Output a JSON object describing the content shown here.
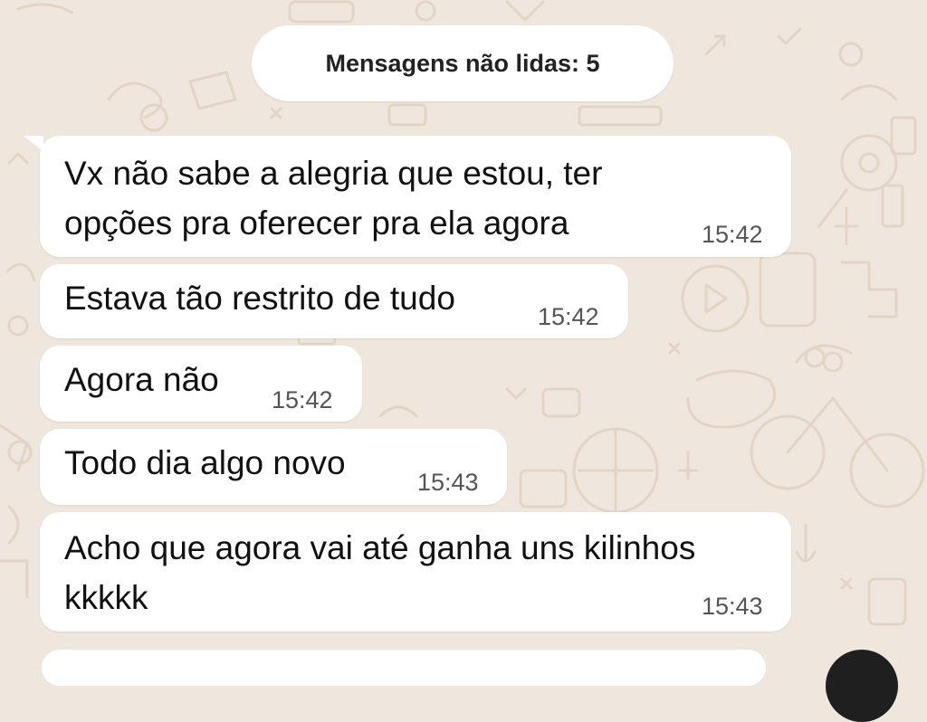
{
  "chat": {
    "unread_label": "Mensagens não lidas: 5",
    "messages": [
      {
        "text": "Vx não sabe a alegria que estou, ter\nopções pra oferecer pra ela agora",
        "time": "15:42"
      },
      {
        "text": "Estava tão restrito de tudo",
        "time": "15:42"
      },
      {
        "text": "Agora não",
        "time": "15:42"
      },
      {
        "text": "Todo dia algo novo",
        "time": "15:43"
      },
      {
        "text": "Acho que agora vai até ganha uns kilinhos\nkkkkk",
        "time": "15:43"
      }
    ]
  },
  "colors": {
    "wallpaper": "#efe7dd",
    "doodle": "#e3d7c8",
    "bubble": "#ffffff",
    "text": "#111111",
    "timestamp": "#555555"
  },
  "icons": [
    "doodle-wallpaper",
    "scroll-to-bottom-button"
  ]
}
